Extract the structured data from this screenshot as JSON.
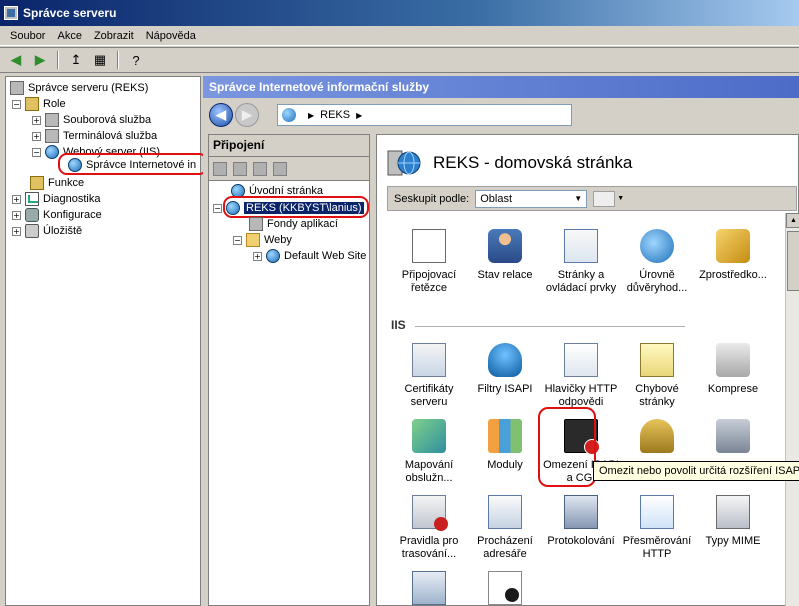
{
  "window": {
    "title": "Správce serveru"
  },
  "menu": [
    "Soubor",
    "Akce",
    "Zobrazit",
    "Nápověda"
  ],
  "left_tree": {
    "root": "Správce serveru (REKS)",
    "roles": "Role",
    "file_service": "Souborová služba",
    "terminal_service": "Terminálová služba",
    "web_server": "Webový server (IIS)",
    "iis_manager": "Správce Internetové in",
    "features": "Funkce",
    "diagnostics": "Diagnostika",
    "configuration": "Konfigurace",
    "storage": "Úložiště"
  },
  "content_header": "Správce Internetové informační služby",
  "address": {
    "server": "REKS"
  },
  "connections": {
    "title": "Připojení",
    "home": "Úvodní stránka",
    "server": "REKS (KKBYST\\lanius)",
    "app_pools": "Fondy aplikací",
    "sites": "Weby",
    "default_site": "Default Web Site"
  },
  "home": {
    "title": "REKS - domovská stránka",
    "group_label": "Seskupit podle:",
    "group_value": "Oblast",
    "section_iis": "IIS"
  },
  "features": {
    "row0": [
      "Připojovací řetězce",
      "Stav relace",
      "Stránky a ovládací prvky",
      "Úrovně důvěryhod...",
      "Zprostředko..."
    ],
    "row1": [
      "Certifikáty serveru",
      "Filtry ISAPI",
      "Hlavičky HTTP odpovědi",
      "Chybové stránky",
      "Komprese"
    ],
    "row2": [
      "Mapování obslužn...",
      "Moduly",
      "Omezení ISAPI a CGI",
      "",
      ""
    ],
    "row3": [
      "Pravidla pro trasování...",
      "Procházení adresáře",
      "Protokolování",
      "Přesměrování HTTP",
      "Typy MIME"
    ]
  },
  "tooltip": "Omezit nebo povolit určitá rozšíření ISAPI"
}
